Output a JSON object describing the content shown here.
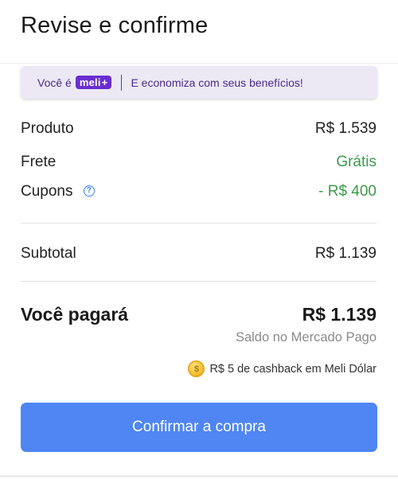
{
  "header": {
    "title": "Revise e confirme"
  },
  "banner": {
    "prefix": "Você é",
    "badge_text": "meli",
    "badge_plus": "+",
    "message": "E economiza com seus benefícios!"
  },
  "summary": {
    "product": {
      "label": "Produto",
      "value": "R$ 1.539"
    },
    "shipping": {
      "label": "Frete",
      "value": "Grátis"
    },
    "coupons": {
      "label": "Cupons",
      "value": "- R$ 400",
      "help_icon": "question-circle-icon"
    },
    "subtotal": {
      "label": "Subtotal",
      "value": "R$ 1.139"
    }
  },
  "total": {
    "label": "Você pagará",
    "value": "R$ 1.139",
    "payment_method": "Saldo no Mercado Pago",
    "cashback_text": "R$ 5 de cashback em Meli Dólar",
    "cashback_icon": "meli-dolar-coin-icon"
  },
  "actions": {
    "confirm_label": "Confirmar a compra"
  },
  "colors": {
    "accent_blue": "#4f86f4",
    "green": "#3d9a4b",
    "meli_purple": "#6a2ed0",
    "banner_bg": "#ece9f4"
  }
}
